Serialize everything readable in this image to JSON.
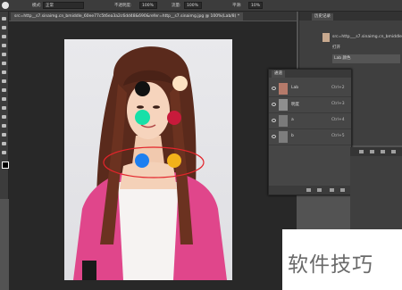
{
  "options_bar": {
    "mode_label": "模式:",
    "mode_value": "正常",
    "opacity_label": "不透明度:",
    "opacity_value": "100%",
    "flow_label": "流量:",
    "flow_value": "100%",
    "smooth_label": "平滑:",
    "smooth_value": "10%"
  },
  "document": {
    "tab_title": "src=http__s7.sinaimg.cn_bmiddle_60ee77c5t6ea3a2c6dd48&690&refer=http__s7.sinaimg.jpg @ 100%(Lab/8) *"
  },
  "history_panel": {
    "title": "历史记录",
    "snapshot": "src=http___s7.sinaimg.cn_bmiddle",
    "items": [
      "打开",
      "Lab 颜色"
    ]
  },
  "channels_panel": {
    "title": "通道",
    "channels": [
      {
        "name": "Lab",
        "shortcut": "Ctrl+2",
        "selected": false
      },
      {
        "name": "明度",
        "shortcut": "Ctrl+3",
        "selected": false
      },
      {
        "name": "a",
        "shortcut": "Ctrl+4",
        "selected": false
      },
      {
        "name": "b",
        "shortcut": "Ctrl+5",
        "selected": false
      }
    ]
  },
  "annotation": {
    "dot_colors": {
      "black": "#111111",
      "cream": "#fde2c2",
      "cyan": "#17e0a8",
      "red": "#c71a3b",
      "blue": "#1d7ff0",
      "yellow": "#f2b21a"
    },
    "ellipse_color": "#e3242b"
  },
  "watermark": {
    "text": "软件技巧"
  }
}
